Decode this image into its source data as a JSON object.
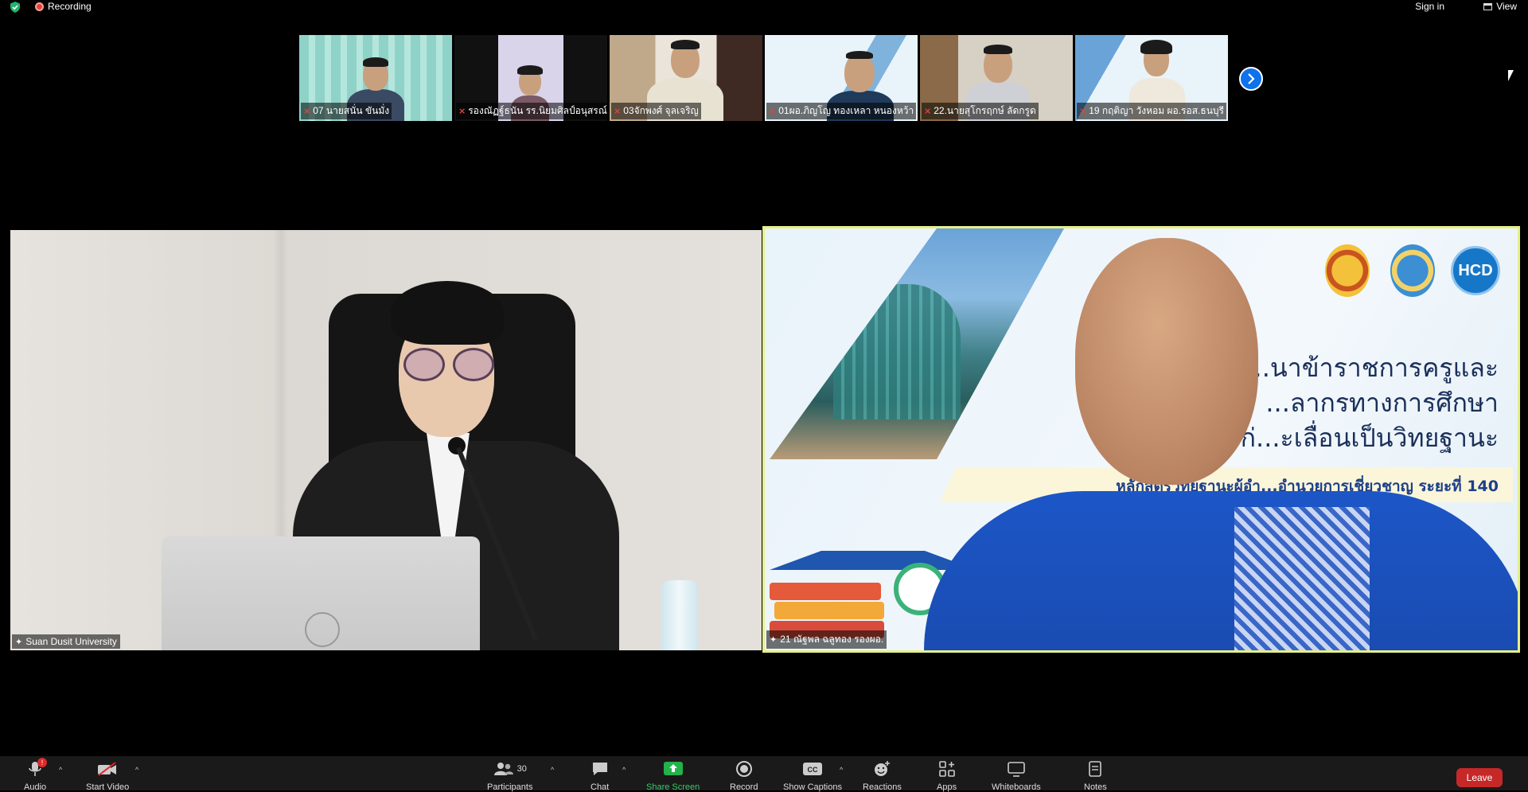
{
  "topbar": {
    "recording_label": "Recording",
    "signin_label": "Sign in",
    "view_label": "View"
  },
  "gallery": [
    {
      "name": "07 นายสนั่น ขันมั่ง"
    },
    {
      "name": "รองณัฏฐ์ธนัน  รร.นิยมศิลป์อนุสรณ์"
    },
    {
      "name": "03จักพงศ์ จุลเจริญ"
    },
    {
      "name": "01ผอ.ภิญโญ  ทองเหลา หนองหว้า"
    },
    {
      "name": "22.นายสุโกรฤกษ์ ลัดกรูด"
    },
    {
      "name": "19 กฤติญา วังหอม ผอ.รอส.ธนบุรี"
    }
  ],
  "main": {
    "left_name": "Suan Dusit University",
    "right_name": "21 ณัฐพล ฉลูทอง รองผอ.",
    "slide": {
      "line1": "...นาข้าราชการครูและ",
      "line2": "...ลากรทางการศึกษา",
      "line3": "ก่...ะเลื่อนเป็นวิทยฐานะ",
      "banner": "หลักสูตรวิทยฐานะผู้อำ...อำนวยการเชี่ยวชาญ ระยะที่ 140",
      "logo3": "HCD"
    }
  },
  "toolbar": {
    "audio": "Audio",
    "audio_badge": "!",
    "video": "Start Video",
    "participants": "Participants",
    "participants_count": "30",
    "chat": "Chat",
    "share": "Share Screen",
    "record": "Record",
    "captions": "Show Captions",
    "reactions": "Reactions",
    "apps": "Apps",
    "whiteboards": "Whiteboards",
    "notes": "Notes",
    "leave": "Leave"
  }
}
